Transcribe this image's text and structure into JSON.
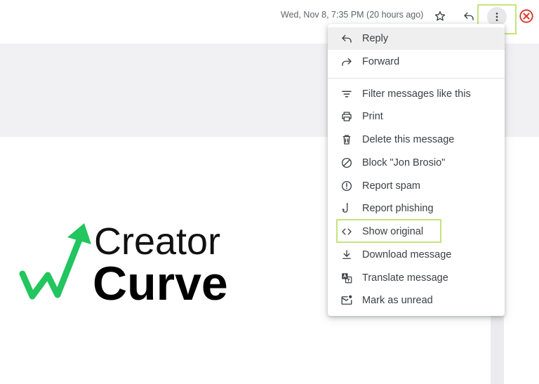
{
  "header": {
    "date": "Wed, Nov 8, 7:35 PM (20 hours ago)",
    "icons": [
      "star-icon",
      "reply-icon",
      "more-vert-icon",
      "close-icon"
    ]
  },
  "menu": {
    "items": [
      {
        "label": "Reply",
        "icon": "reply-icon"
      },
      {
        "label": "Forward",
        "icon": "forward-icon"
      },
      {
        "label": "Filter messages like this",
        "icon": "filter-icon"
      },
      {
        "label": "Print",
        "icon": "print-icon"
      },
      {
        "label": "Delete this message",
        "icon": "trash-icon"
      },
      {
        "label": "Block \"Jon Brosio\"",
        "icon": "block-icon"
      },
      {
        "label": "Report spam",
        "icon": "report-spam-icon"
      },
      {
        "label": "Report phishing",
        "icon": "phishing-hook-icon"
      },
      {
        "label": "Show original",
        "icon": "code-icon"
      },
      {
        "label": "Download message",
        "icon": "download-icon"
      },
      {
        "label": "Translate message",
        "icon": "translate-icon"
      },
      {
        "label": "Mark as unread",
        "icon": "mark-unread-icon"
      }
    ]
  },
  "logo": {
    "line1": "Creator",
    "line2": "Curve",
    "accent": "#22c55e"
  },
  "colors": {
    "highlight": "#c4e57a",
    "close": "#d93025",
    "icon": "#5f6368"
  }
}
